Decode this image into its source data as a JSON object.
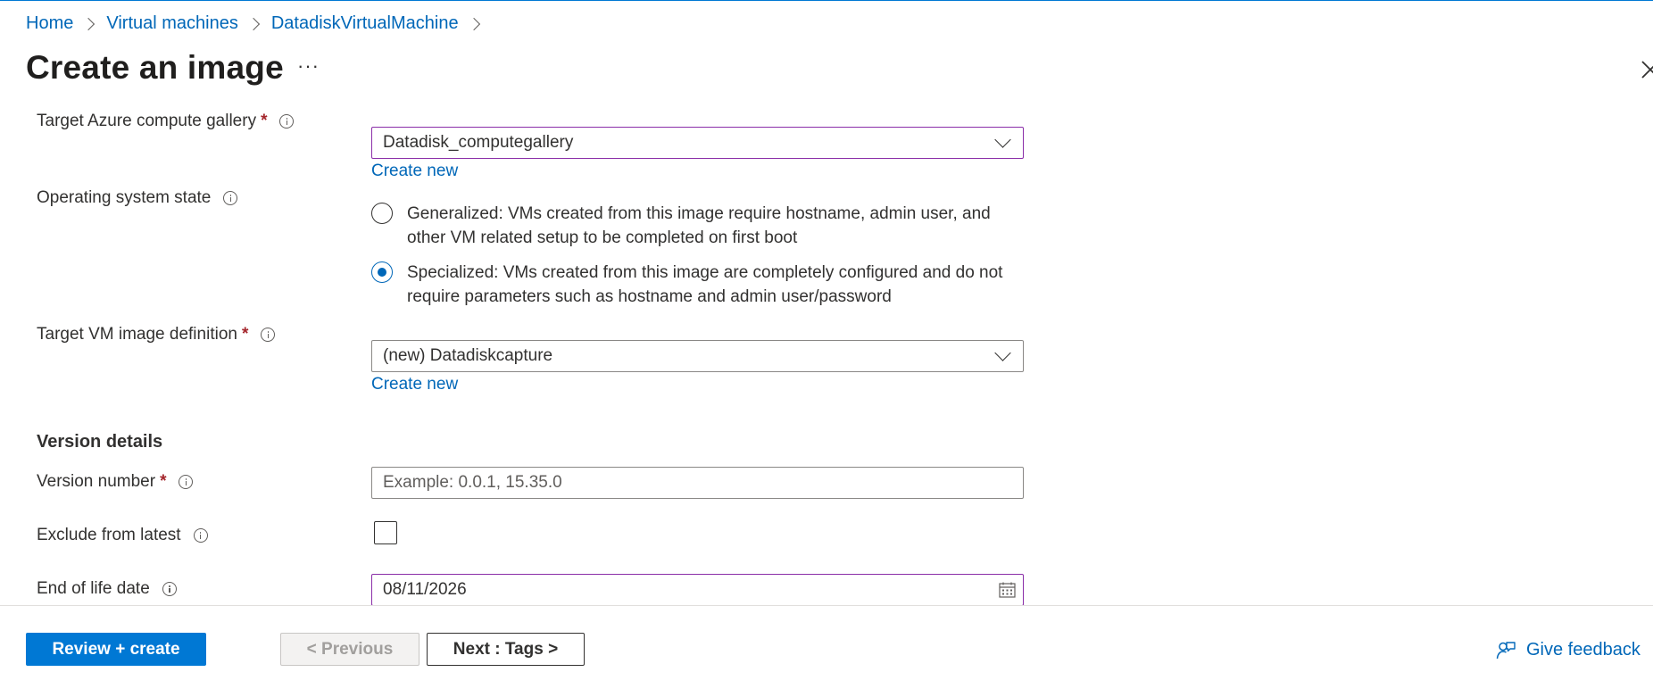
{
  "breadcrumb": {
    "items": [
      "Home",
      "Virtual machines",
      "DatadiskVirtualMachine"
    ]
  },
  "page": {
    "title": "Create an image",
    "more_label": "···"
  },
  "form": {
    "gallery": {
      "label": "Target Azure compute gallery",
      "required_mark": "*",
      "value": "Datadisk_computegallery",
      "create_new": "Create new"
    },
    "os_state": {
      "label": "Operating system state",
      "options": [
        {
          "text": "Generalized: VMs created from this image require hostname, admin user, and other VM related setup to be completed on first boot",
          "selected": false
        },
        {
          "text": "Specialized: VMs created from this image are completely configured and do not require parameters such as hostname and admin user/password",
          "selected": true
        }
      ]
    },
    "image_definition": {
      "label": "Target VM image definition",
      "required_mark": "*",
      "value": "(new) Datadiskcapture",
      "create_new": "Create new"
    },
    "version_details": {
      "heading": "Version details",
      "version_number": {
        "label": "Version number",
        "required_mark": "*",
        "value": "",
        "placeholder": "Example: 0.0.1, 15.35.0"
      },
      "exclude_latest": {
        "label": "Exclude from latest",
        "checked": false
      },
      "end_of_life": {
        "label": "End of life date",
        "value": "08/11/2026"
      }
    }
  },
  "footer": {
    "review_create": "Review + create",
    "previous": "< Previous",
    "next": "Next : Tags >",
    "feedback": "Give feedback"
  },
  "colors": {
    "accent": "#0078d4",
    "link": "#0067b8",
    "focus_border": "#8a2ea8",
    "required": "#a4262c"
  },
  "icons": [
    "chevron-right-icon",
    "more-icon",
    "close-icon",
    "info-icon",
    "chevron-down-icon",
    "calendar-icon",
    "feedback-icon"
  ]
}
